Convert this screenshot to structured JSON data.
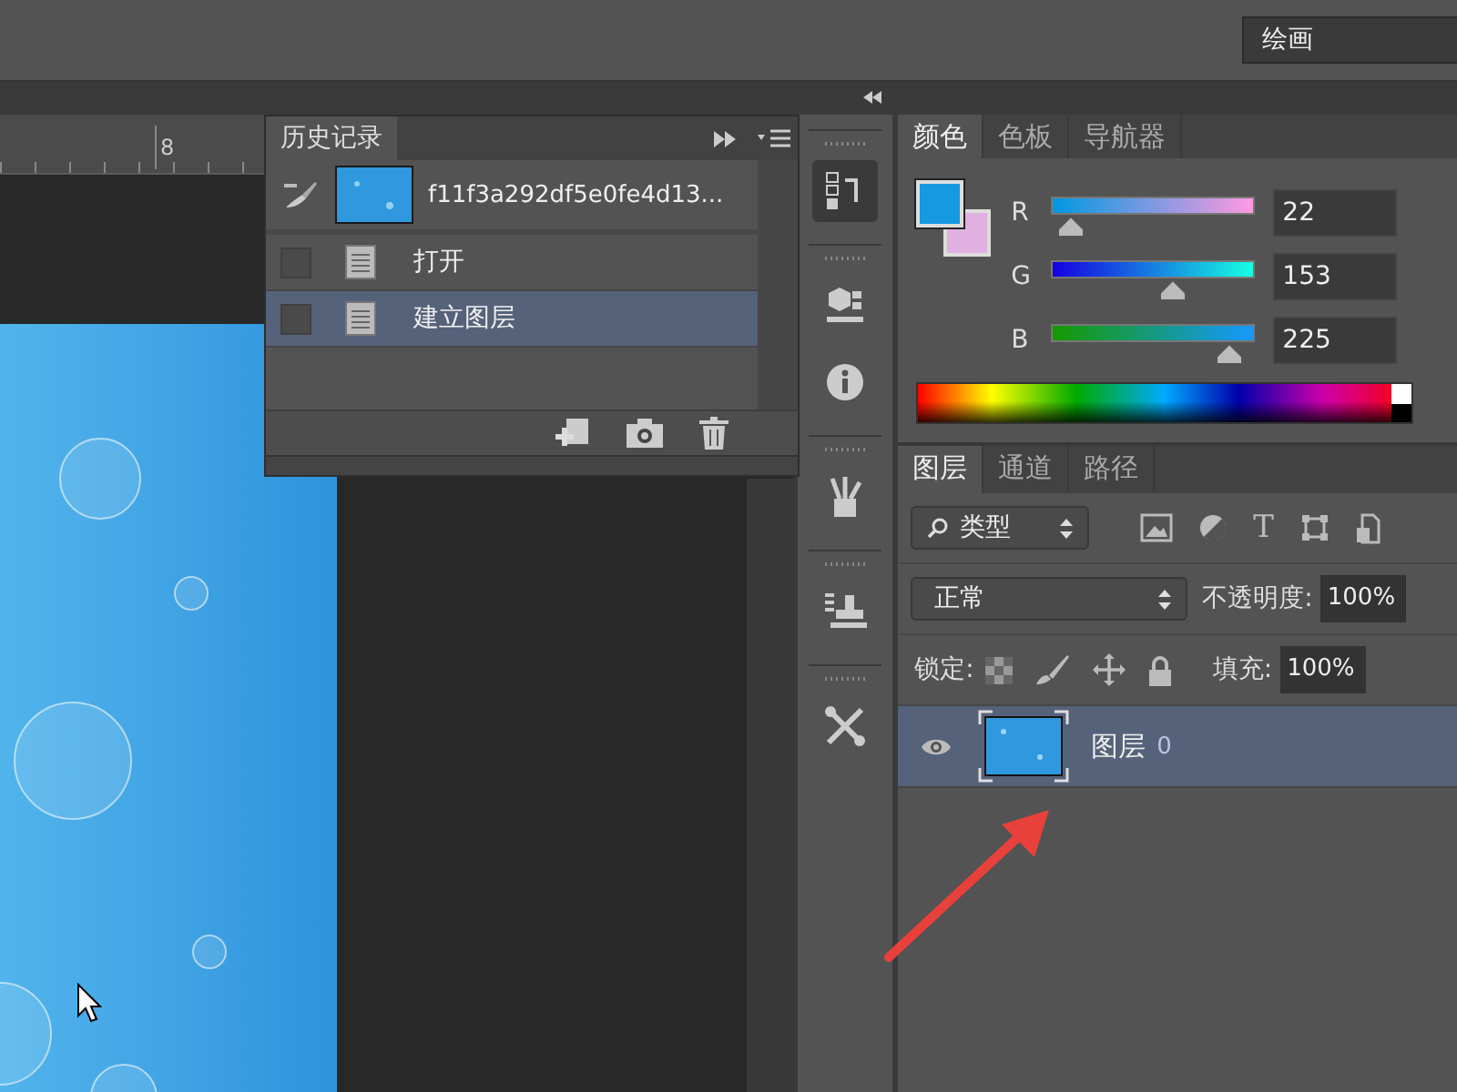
{
  "workspace": {
    "value": "绘画"
  },
  "ruler": {
    "labels": [
      "8"
    ]
  },
  "history_panel": {
    "tab": "历史记录",
    "snapshot": "f11f3a292df5e0fe4d13...",
    "states": [
      {
        "label": "打开",
        "selected": false
      },
      {
        "label": "建立图层",
        "selected": true
      }
    ]
  },
  "color_panel": {
    "tabs": [
      {
        "label": "颜色",
        "selected": true
      },
      {
        "label": "色板",
        "selected": false
      },
      {
        "label": "导航器",
        "selected": false
      }
    ],
    "channels": [
      {
        "name": "R",
        "value": "22",
        "level": 0.086
      },
      {
        "name": "G",
        "value": "153",
        "level": 0.6
      },
      {
        "name": "B",
        "value": "225",
        "level": 0.882
      }
    ]
  },
  "layers_panel": {
    "tabs": [
      {
        "label": "图层",
        "selected": true
      },
      {
        "label": "通道",
        "selected": false
      },
      {
        "label": "路径",
        "selected": false
      }
    ],
    "filter": {
      "value": "类型",
      "type_glyph": "T"
    },
    "blend_mode": {
      "value": "正常"
    },
    "opacity": {
      "label": "不透明度:",
      "value": "100%"
    },
    "lock": {
      "label": "锁定:"
    },
    "fill": {
      "label": "填充:",
      "value": "100%"
    },
    "layers": [
      {
        "name": "图层",
        "suffix": "0",
        "visible": true,
        "selected": true
      }
    ]
  }
}
